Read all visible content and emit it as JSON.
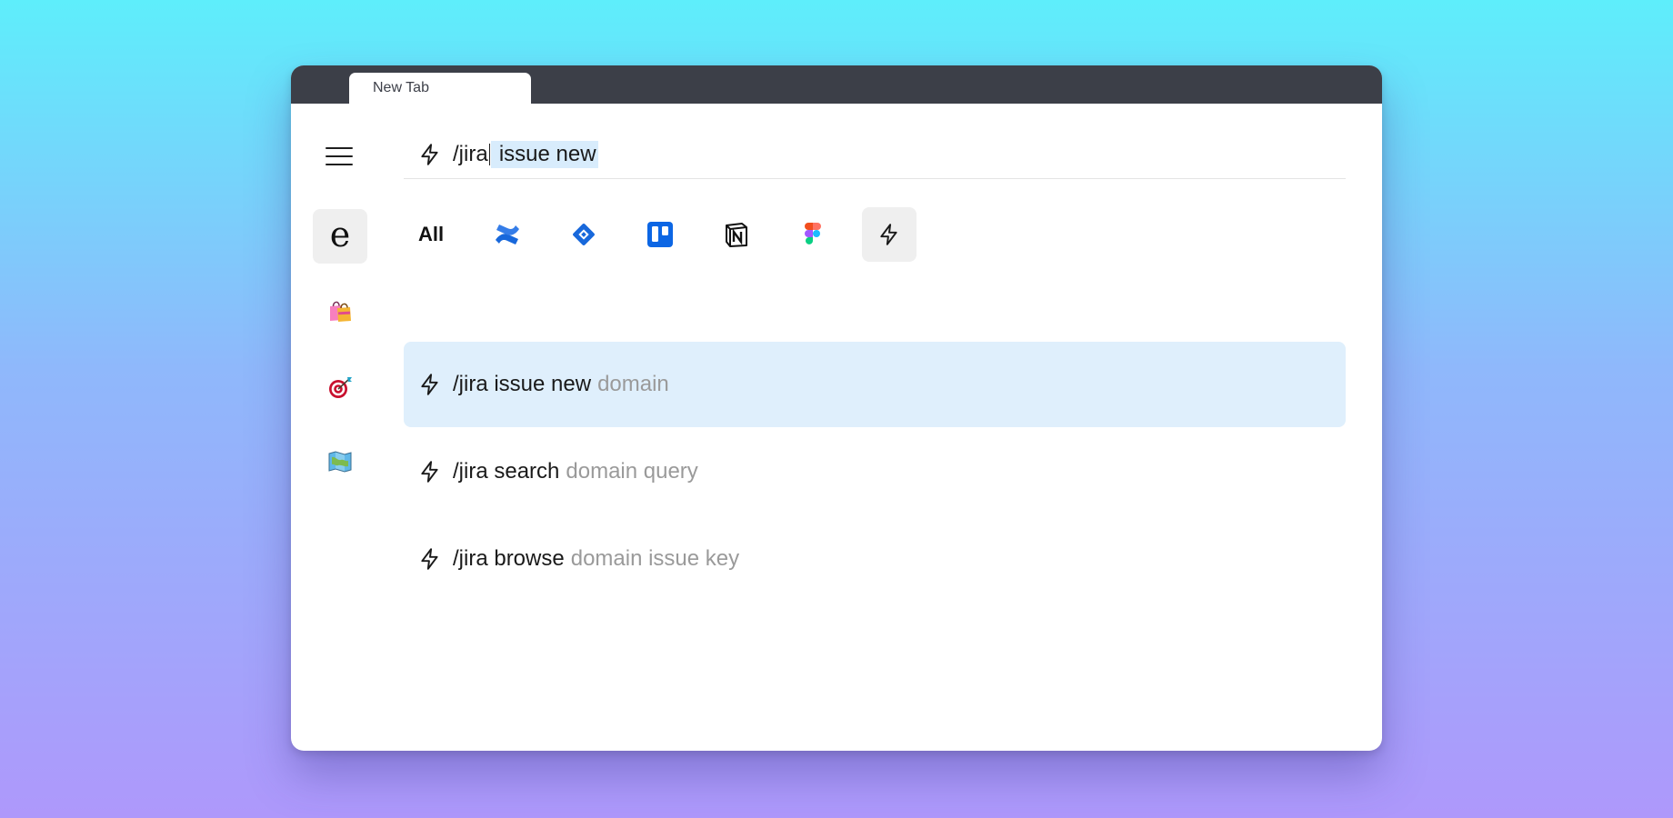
{
  "window": {
    "tab": {
      "title": "New Tab"
    }
  },
  "sidebar": {
    "menu_icon": "hamburger-menu-icon",
    "items": [
      {
        "name": "e-letter-icon",
        "glyph": "e",
        "active": true
      },
      {
        "name": "shopping-bags-icon",
        "glyph": "🛍️",
        "active": false
      },
      {
        "name": "direct-hit-target-icon",
        "glyph": "🎯",
        "active": false
      },
      {
        "name": "map-icon",
        "glyph": "🗺️",
        "active": false
      }
    ]
  },
  "search": {
    "icon": "lightning-bolt-icon",
    "query_before_caret": "/jira",
    "query_selected": " issue new"
  },
  "filters": {
    "all_label": "All",
    "items": [
      {
        "name": "confluence-icon",
        "active": false
      },
      {
        "name": "jira-icon",
        "active": false
      },
      {
        "name": "trello-icon",
        "active": false
      },
      {
        "name": "notion-icon",
        "active": false
      },
      {
        "name": "figma-icon",
        "active": false
      },
      {
        "name": "lightning-bolt-icon",
        "active": true
      }
    ]
  },
  "results": [
    {
      "command": "/jira issue new",
      "args": "domain",
      "highlighted": true
    },
    {
      "command": "/jira search",
      "args": "domain query",
      "highlighted": false
    },
    {
      "command": "/jira browse",
      "args": "domain issue key",
      "highlighted": false
    }
  ],
  "colors": {
    "background_top": "#5eeefb",
    "background_bottom": "#ae98fb",
    "tabbar": "#3c3f48",
    "highlight": "#dfeffc",
    "selection": "#d8ecfc",
    "muted_text": "#9a9a9a",
    "confluence_blue": "#1868db",
    "jira_blue": "#1868db",
    "trello_blue": "#0c66e4"
  }
}
